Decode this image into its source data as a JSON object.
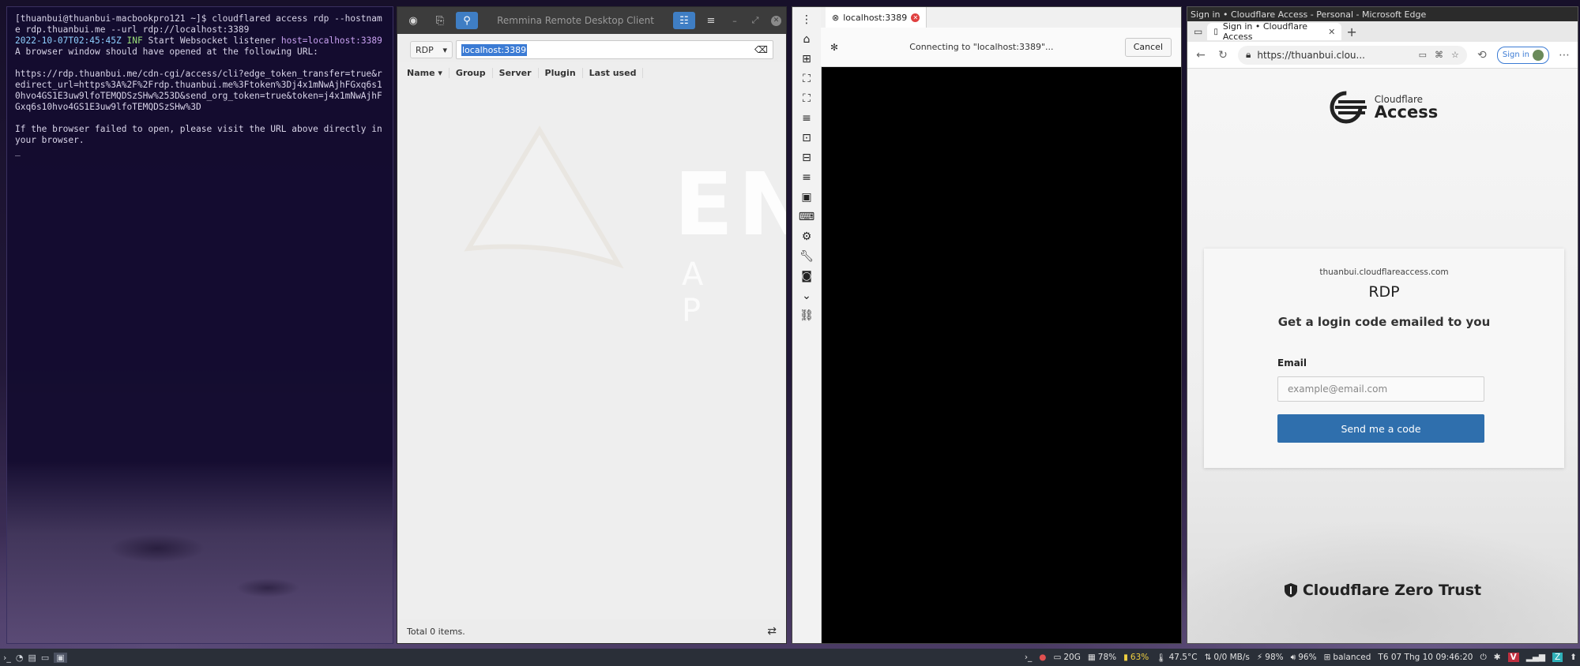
{
  "terminal": {
    "lines": [
      "[thuanbui@thuanbui-macbookpro121 ~]$ cloudflared access rdp --hostname rdp.thuanbui.me --url rdp://localhost:3389",
      "",
      "A browser window should have opened at the following URL:",
      "",
      "https://rdp.thuanbui.me/cdn-cgi/access/cli?edge_token_transfer=true&redirect_url=https%3A%2F%2Frdp.thuanbui.me%3Ftoken%3Dj4x1mNwAjhFGxq6s10hvo4GS1E3uw9lfoTEMQDSzSHw%253D&send_org_token=true&token=j4x1mNwAjhFGxq6s10hvo4GS1E3uw9lfoTEMQDSzSHw%3D",
      "",
      "If the browser failed to open, please visit the URL above directly in your browser.",
      "_"
    ],
    "log_date": "2022-10-07T02:45:45Z",
    "log_level": "INF",
    "log_message": "Start Websocket listener",
    "log_host": "host=localhost:3389"
  },
  "remmina": {
    "title": "Remmina Remote Desktop Client",
    "protocol": "RDP",
    "search_value": "localhost:3389",
    "columns": [
      "Name",
      "Group",
      "Server",
      "Plugin",
      "Last used"
    ],
    "watermark_word": "END",
    "watermark_sub": "A P",
    "status": "Total 0 items."
  },
  "rdp_viewer": {
    "tab_label": "localhost:3389",
    "connecting_text": "Connecting to \"localhost:3389\"...",
    "cancel_label": "Cancel"
  },
  "browser": {
    "window_title": "Sign in  •  Cloudflare Access - Personal - Microsoft Edge",
    "tab_title": "Sign in  •  Cloudflare Access",
    "url": "https://thuanbui.clou...",
    "signin_label": "Sign in",
    "page": {
      "logo_small": "Cloudflare",
      "logo_big": "Access",
      "domain": "thuanbui.cloudflareaccess.com",
      "app_name": "RDP",
      "heading": "Get a login code emailed to you",
      "email_label": "Email",
      "email_placeholder": "example@email.com",
      "email_value": "",
      "button_label": "Send me a code",
      "footer": "Cloudflare Zero Trust"
    }
  },
  "taskbar": {
    "disk": "20G",
    "memory": "78%",
    "battery": "63%",
    "temperature": "47.5°C",
    "network": "0/0 MB/s",
    "power": "98%",
    "volume": "96%",
    "profile": "balanced",
    "clock": "T6 07 Thg 10 09:46:20"
  },
  "colors": {
    "cloudflare_button": "#2f6fad",
    "remmina_active": "#3f7ec4",
    "terminal_bg": "#140c30"
  }
}
